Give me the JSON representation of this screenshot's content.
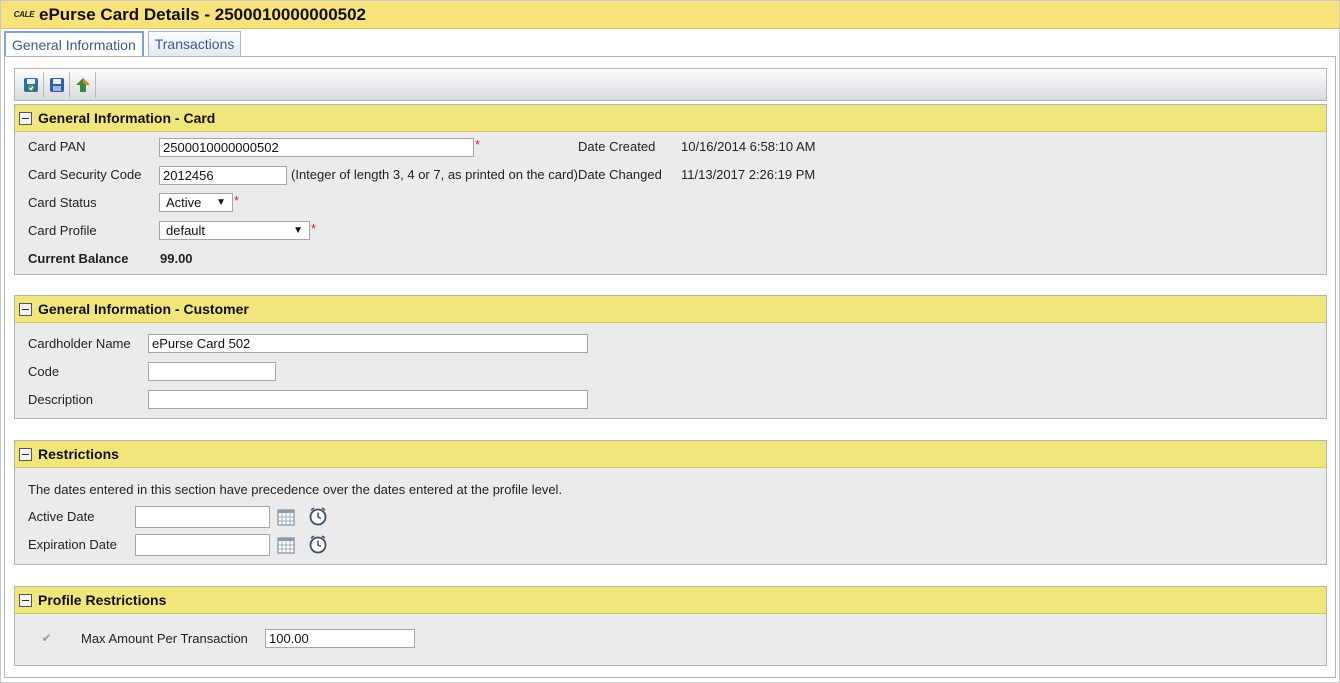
{
  "header": {
    "logo_text": "CALE",
    "title": "ePurse Card Details - 2500010000000502"
  },
  "tabs": [
    {
      "label": "General Information",
      "active": true
    },
    {
      "label": "Transactions",
      "active": false
    }
  ],
  "toolbar": {
    "buttons": [
      "save-and-close-icon",
      "save-icon",
      "upload-icon"
    ]
  },
  "card_section": {
    "title": "General Information - Card",
    "card_pan_label": "Card PAN",
    "card_pan_value": "2500010000000502",
    "security_code_label": "Card Security Code",
    "security_code_value": "2012456",
    "security_code_hint": "(Integer of length 3, 4 or 7, as printed on the card)",
    "card_status_label": "Card Status",
    "card_status_value": "Active",
    "card_profile_label": "Card Profile",
    "card_profile_value": "default",
    "current_balance_label": "Current Balance",
    "current_balance_value": "99.00",
    "date_created_label": "Date Created",
    "date_created_value": "10/16/2014 6:58:10 AM",
    "date_changed_label": "Date Changed",
    "date_changed_value": "11/13/2017 2:26:19 PM",
    "required_mark": "*"
  },
  "customer_section": {
    "title": "General Information - Customer",
    "cardholder_name_label": "Cardholder Name",
    "cardholder_name_value": "ePurse Card 502",
    "code_label": "Code",
    "code_value": "",
    "description_label": "Description",
    "description_value": ""
  },
  "restrictions_section": {
    "title": "Restrictions",
    "note": "The dates entered in this section have precedence over the dates entered at the profile level.",
    "active_date_label": "Active Date",
    "active_date_value": "",
    "expiration_date_label": "Expiration Date",
    "expiration_date_value": ""
  },
  "profile_restrictions_section": {
    "title": "Profile Restrictions",
    "max_amount_label": "Max Amount Per Transaction",
    "max_amount_value": "100.00",
    "max_amount_checked": true
  },
  "colors": {
    "title_bar": "#f8e27a",
    "section_header": "#f1e67c",
    "section_body": "#ebebeb",
    "tab_text": "#3a5a8c",
    "required": "#dd2222"
  }
}
